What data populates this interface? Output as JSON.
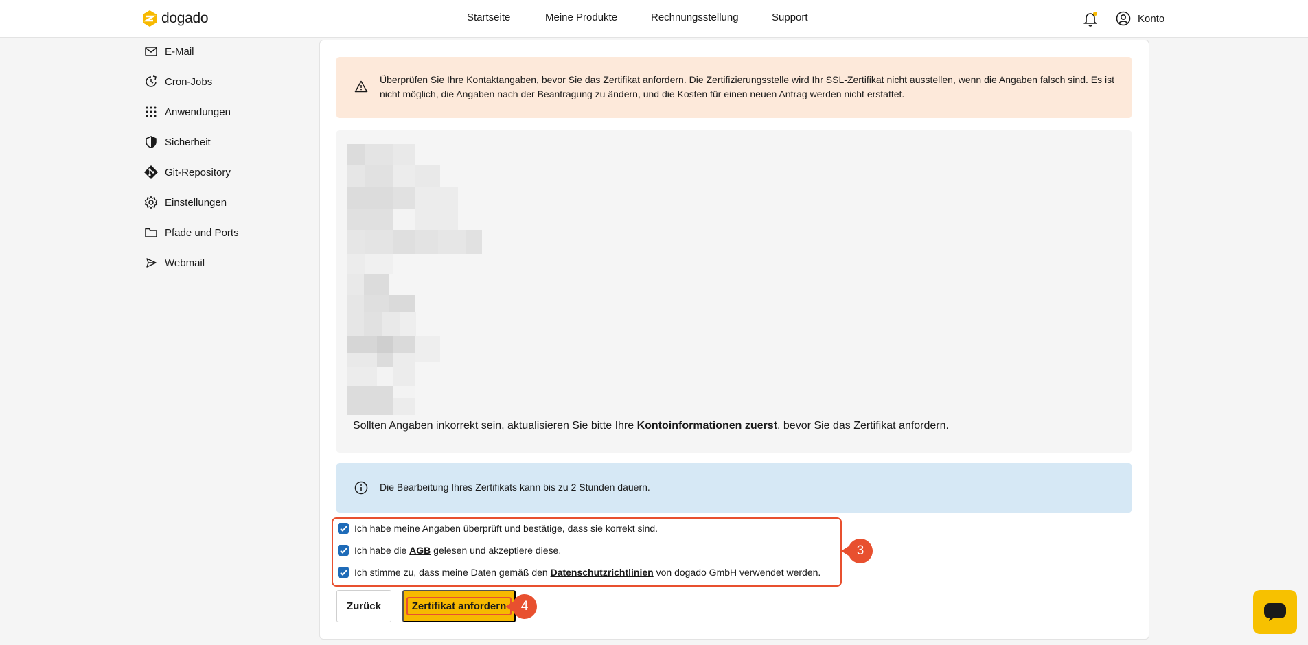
{
  "brand": {
    "name": "dogado",
    "accent": "#f7b900"
  },
  "nav": {
    "items": [
      {
        "label": "Startseite"
      },
      {
        "label": "Meine Produkte"
      },
      {
        "label": "Rechnungsstellung"
      },
      {
        "label": "Support"
      }
    ],
    "account_label": "Konto"
  },
  "sidebar": {
    "items": [
      {
        "label": "E-Mail",
        "icon": "mail-icon"
      },
      {
        "label": "Cron-Jobs",
        "icon": "clock-icon"
      },
      {
        "label": "Anwendungen",
        "icon": "grid-icon"
      },
      {
        "label": "Sicherheit",
        "icon": "shield-icon"
      },
      {
        "label": "Git-Repository",
        "icon": "git-icon"
      },
      {
        "label": "Einstellungen",
        "icon": "gear-icon"
      },
      {
        "label": "Pfade und Ports",
        "icon": "folder-icon"
      },
      {
        "label": "Webmail",
        "icon": "send-icon"
      }
    ]
  },
  "warning": {
    "text": "Überprüfen Sie Ihre Kontaktangaben, bevor Sie das Zertifikat anfordern. Die Zertifizierungsstelle wird Ihr SSL-Zertifikat nicht ausstellen, wenn die Angaben falsch sind. Es ist nicht möglich, die Angaben nach der Beantragung zu ändern, und die Kosten für einen neuen Antrag werden nicht erstattet."
  },
  "contact": {
    "text_before": "Sollten Angaben inkorrekt sein, aktualisieren Sie bitte Ihre ",
    "link": "Kontoinformationen zuerst",
    "text_after": ", bevor Sie das Zertifikat anfordern."
  },
  "info": {
    "text": "Die Bearbeitung Ihres Zertifikats kann bis zu 2 Stunden dauern."
  },
  "checks": {
    "c1": "Ich habe meine Angaben überprüft und bestätige, dass sie korrekt sind.",
    "c2_before": "Ich habe die ",
    "c2_link": "AGB",
    "c2_after": " gelesen und akzeptiere diese.",
    "c3_before": "Ich stimme zu, dass meine Daten gemäß den ",
    "c3_link": "Datenschutzrichtlinien",
    "c3_after": " von dogado GmbH verwendet werden.",
    "checked": [
      true,
      true,
      true
    ]
  },
  "annotations": {
    "step_checks": "3",
    "step_button": "4"
  },
  "buttons": {
    "back": "Zurück",
    "request": "Zertifikat anfordern"
  }
}
